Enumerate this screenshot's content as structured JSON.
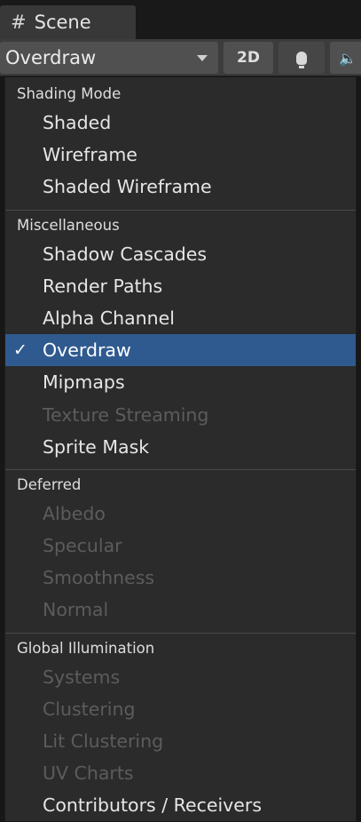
{
  "tab": {
    "icon": "grid-hash-icon",
    "icon_glyph": "#",
    "label": "Scene"
  },
  "toolbar": {
    "draw_mode": "Overdraw",
    "btn_2d": "2D",
    "light_icon": "lightbulb-icon",
    "audio_icon": "speaker-icon",
    "audio_glyph": "🔈"
  },
  "menu": {
    "check_glyph": "✓",
    "sections": [
      {
        "header": "Shading Mode",
        "items": [
          {
            "label": "Shaded",
            "enabled": true,
            "selected": false
          },
          {
            "label": "Wireframe",
            "enabled": true,
            "selected": false
          },
          {
            "label": "Shaded Wireframe",
            "enabled": true,
            "selected": false
          }
        ]
      },
      {
        "header": "Miscellaneous",
        "items": [
          {
            "label": "Shadow Cascades",
            "enabled": true,
            "selected": false
          },
          {
            "label": "Render Paths",
            "enabled": true,
            "selected": false
          },
          {
            "label": "Alpha Channel",
            "enabled": true,
            "selected": false
          },
          {
            "label": "Overdraw",
            "enabled": true,
            "selected": true
          },
          {
            "label": "Mipmaps",
            "enabled": true,
            "selected": false
          },
          {
            "label": "Texture Streaming",
            "enabled": false,
            "selected": false
          },
          {
            "label": "Sprite Mask",
            "enabled": true,
            "selected": false
          }
        ]
      },
      {
        "header": "Deferred",
        "items": [
          {
            "label": "Albedo",
            "enabled": false,
            "selected": false
          },
          {
            "label": "Specular",
            "enabled": false,
            "selected": false
          },
          {
            "label": "Smoothness",
            "enabled": false,
            "selected": false
          },
          {
            "label": "Normal",
            "enabled": false,
            "selected": false
          }
        ]
      },
      {
        "header": "Global Illumination",
        "items": [
          {
            "label": "Systems",
            "enabled": false,
            "selected": false
          },
          {
            "label": "Clustering",
            "enabled": false,
            "selected": false
          },
          {
            "label": "Lit Clustering",
            "enabled": false,
            "selected": false
          },
          {
            "label": "UV Charts",
            "enabled": false,
            "selected": false
          },
          {
            "label": "Contributors / Receivers",
            "enabled": true,
            "selected": false
          }
        ]
      }
    ]
  },
  "colors": {
    "selected_bg": "#2f5a8f",
    "menu_bg": "#2b2b2b",
    "disabled_text": "#5c5c5c"
  }
}
